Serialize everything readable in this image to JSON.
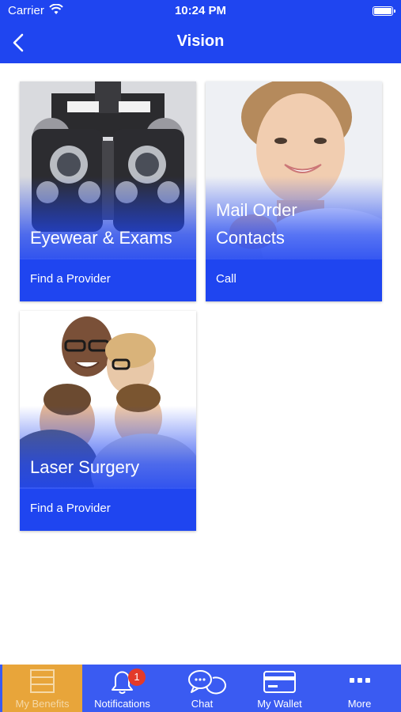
{
  "status_bar": {
    "carrier": "Carrier",
    "time": "10:24 PM"
  },
  "nav": {
    "title": "Vision"
  },
  "tiles": [
    {
      "label": "Eyewear & Exams",
      "action": "Find a Provider"
    },
    {
      "label_line1": "Mail Order",
      "label_line2": "Contacts",
      "action": "Call"
    },
    {
      "label": "Laser Surgery",
      "action": "Find a Provider"
    }
  ],
  "tab_bar": {
    "items": [
      {
        "label": "My Benefits",
        "icon": "list-icon",
        "active": true
      },
      {
        "label": "Notifications",
        "icon": "bell-icon",
        "badge": "1"
      },
      {
        "label": "Chat",
        "icon": "chat-icon"
      },
      {
        "label": "My Wallet",
        "icon": "card-icon"
      },
      {
        "label": "More",
        "icon": "more-dots-icon"
      }
    ]
  },
  "colors": {
    "brand_blue": "#1f45f0",
    "tab_active": "#e8a53a",
    "badge_red": "#e33a2a"
  }
}
